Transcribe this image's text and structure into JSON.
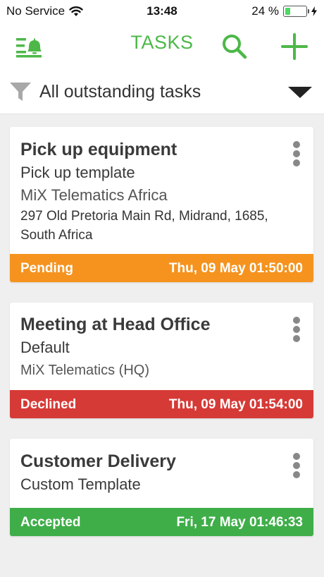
{
  "status_bar": {
    "carrier": "No Service",
    "time": "13:48",
    "battery_percent": "24 %",
    "battery_level": 0.24
  },
  "header": {
    "title": "TASKS",
    "menu_icon": "bell-menu-icon",
    "search_icon": "search-icon",
    "add_icon": "plus-icon",
    "accent_color": "#4db848"
  },
  "filter": {
    "label": "All outstanding tasks",
    "icon": "filter-icon",
    "dropdown_icon": "chevron-down-icon"
  },
  "tasks": [
    {
      "title": "Pick up equipment",
      "template": "Pick up template",
      "organization": "MiX Telematics Africa",
      "address": "297 Old Pretoria Main Rd,  Midrand, 1685,  South Africa",
      "status": "Pending",
      "datetime": "Thu, 09 May 01:50:00",
      "status_color": "#f5931e"
    },
    {
      "title": "Meeting at Head Office",
      "template": "Default",
      "organization": "MiX Telematics (HQ)",
      "status": "Declined",
      "datetime": "Thu, 09 May 01:54:00",
      "status_color": "#d63a36"
    },
    {
      "title": "Customer Delivery",
      "template": "Custom Template",
      "status": "Accepted",
      "datetime": "Fri, 17 May 01:46:33",
      "status_color": "#3fae49"
    }
  ]
}
